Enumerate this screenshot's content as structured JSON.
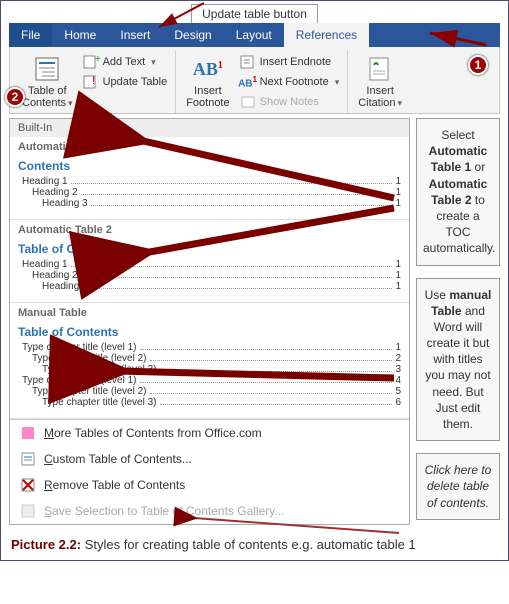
{
  "label_top": "Update table button",
  "ribbon": {
    "tabs": [
      "File",
      "Home",
      "Insert",
      "Design",
      "Layout",
      "References"
    ],
    "toc_btn": "Table of\nContents",
    "add_text": "Add Text",
    "update_table": "Update Table",
    "insert_footnote": "Insert\nFootnote",
    "insert_endnote": "Insert Endnote",
    "next_footnote": "Next Footnote",
    "show_notes": "Show Notes",
    "insert_citation": "Insert\nCitation"
  },
  "badges": {
    "one": "1",
    "two": "2"
  },
  "gallery": {
    "header": "Built-In",
    "auto1": {
      "title": "Automatic Table 1",
      "heading": "Contents",
      "rows": [
        {
          "t": "Heading 1",
          "p": "1",
          "i": 0
        },
        {
          "t": "Heading 2",
          "p": "1",
          "i": 1
        },
        {
          "t": "Heading 3",
          "p": "1",
          "i": 2
        }
      ]
    },
    "auto2": {
      "title": "Automatic Table 2",
      "heading": "Table of Contents",
      "rows": [
        {
          "t": "Heading 1",
          "p": "1",
          "i": 0
        },
        {
          "t": "Heading 2",
          "p": "1",
          "i": 1
        },
        {
          "t": "Heading 3",
          "p": "1",
          "i": 2
        }
      ]
    },
    "manual": {
      "title": "Manual Table",
      "heading": "Table of Contents",
      "rows": [
        {
          "t": "Type chapter title (level 1)",
          "p": "1",
          "i": 0
        },
        {
          "t": "Type chapter title (level 2)",
          "p": "2",
          "i": 1
        },
        {
          "t": "Type chapter title (level 3)",
          "p": "3",
          "i": 2
        },
        {
          "t": "Type chapter title (level 1)",
          "p": "4",
          "i": 0
        },
        {
          "t": "Type chapter title (level 2)",
          "p": "5",
          "i": 1
        },
        {
          "t": "Type chapter title (level 3)",
          "p": "6",
          "i": 2
        }
      ]
    },
    "menu": {
      "more": "More Tables of Contents from Office.com",
      "custom": "Custom Table of Contents...",
      "remove": "Remove Table of Contents",
      "save": "Save Selection to Table of Contents Gallery..."
    }
  },
  "callouts": {
    "c1_a": "Select ",
    "c1_b": "Automatic Table 1",
    "c1_c": " or ",
    "c1_d": "Automatic Table 2",
    "c1_e": " to create a TOC automatically.",
    "c2_a": "Use ",
    "c2_b": "manual Table",
    "c2_c": " and Word will create it but with titles you may not need. But Just edit them.",
    "c3": "Click here to delete table of contents."
  },
  "caption": {
    "label": "Picture 2.2:",
    "text": " Styles for creating table of contents e.g. automatic table 1"
  }
}
